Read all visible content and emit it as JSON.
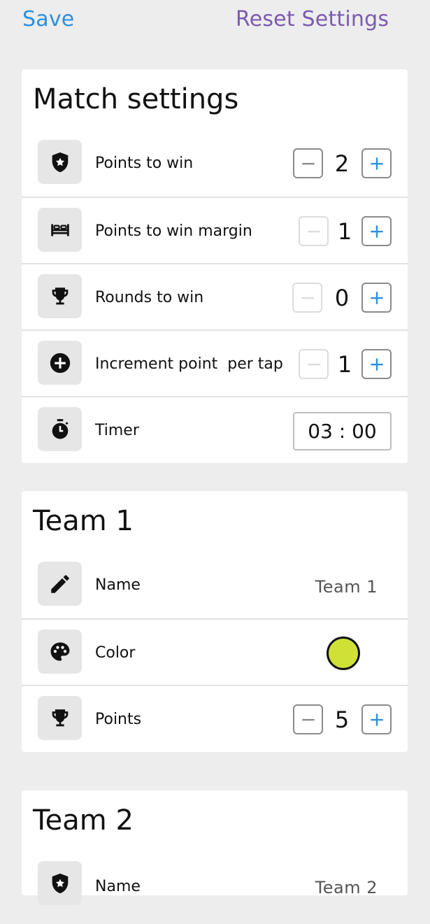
{
  "topbar": {
    "save_label": "Save",
    "reset_label": "Reset Settings"
  },
  "match": {
    "title": "Match settings",
    "rows": [
      {
        "label": "Points to win",
        "value": "2",
        "minus_disabled": false
      },
      {
        "label": "Points to win margin",
        "value": "1",
        "minus_disabled": true
      },
      {
        "label": "Rounds to win",
        "value": "0",
        "minus_disabled": true
      },
      {
        "label": "Increment point  per tap",
        "value": "1",
        "minus_disabled": true
      }
    ],
    "timer": {
      "label": "Timer",
      "value": "03 : 00"
    }
  },
  "team1": {
    "title": "Team 1",
    "name_label": "Name",
    "name_value": "Team 1",
    "color_label": "Color",
    "color_value": "#cfe037",
    "points_label": "Points",
    "points_value": "5"
  },
  "team2": {
    "title": "Team 2",
    "name_label": "Name",
    "name_value": "Team 2"
  },
  "colors": {
    "save": "#2f8fdc",
    "reset": "#7b5bb0",
    "plus_icon": "#2f8fdc",
    "minus_icon": "#8a8a8a"
  },
  "icons": {
    "points_to_win": "shield-star-icon",
    "margin": "bed-icon",
    "rounds": "trophy-icon",
    "increment": "plus-circle-icon",
    "timer": "stopwatch-icon",
    "name": "pencil-icon",
    "color": "palette-icon",
    "points": "trophy-icon"
  }
}
